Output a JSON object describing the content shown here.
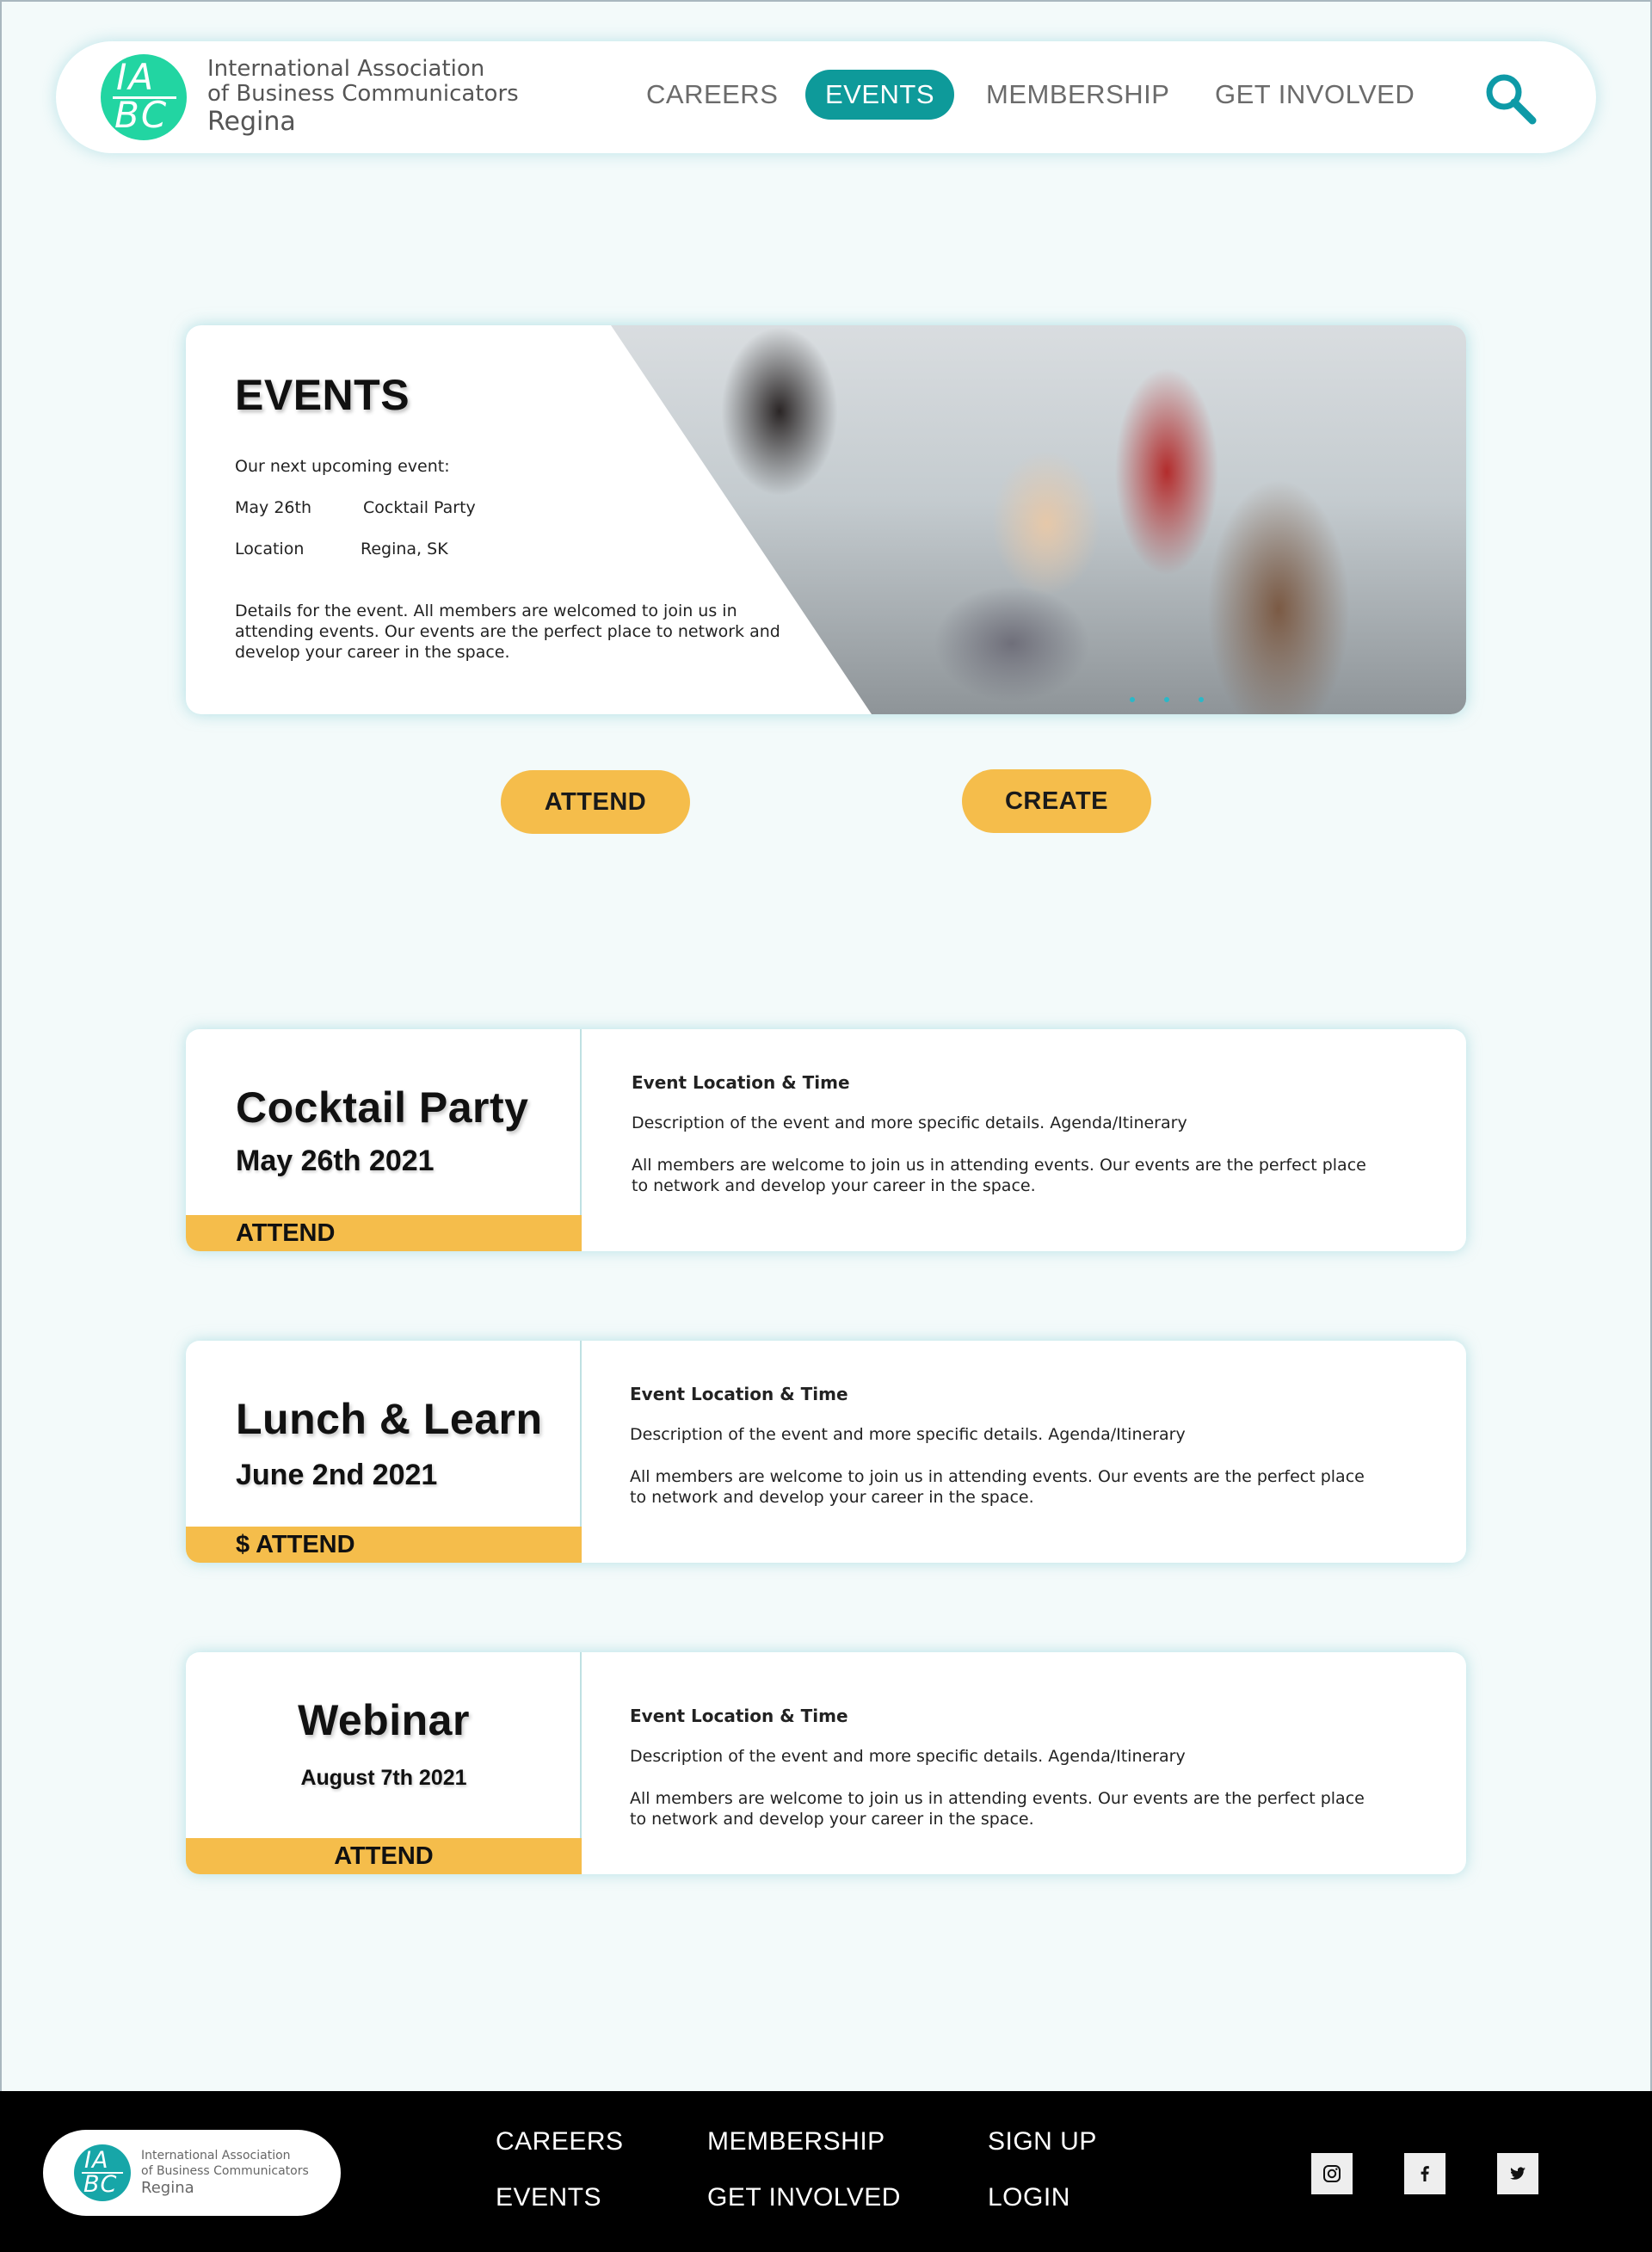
{
  "header": {
    "logo": {
      "mark_top": "IA",
      "mark_bottom": "BC",
      "line1": "International Association",
      "line2": "of Business Communicators",
      "line3": "Regina"
    },
    "nav": [
      {
        "label": "CAREERS",
        "active": false
      },
      {
        "label": "EVENTS",
        "active": true
      },
      {
        "label": "MEMBERSHIP",
        "active": false
      },
      {
        "label": "GET INVOLVED",
        "active": false
      }
    ],
    "search_icon": "search-icon"
  },
  "hero": {
    "title": "EVENTS",
    "upcoming_label": "Our next upcoming event:",
    "date": "May 26th",
    "event_name": "Cocktail Party",
    "location_label": "Location",
    "location_value": "Regina, SK",
    "details": "Details for the event. All members are welcomed to join us in attending events. Our events are the perfect place to network and develop your career in the space.",
    "carousel_dots": 3
  },
  "actions": {
    "attend": "ATTEND",
    "create": "CREATE"
  },
  "events": [
    {
      "name": "Cocktail Party",
      "date": "May 26th 2021",
      "attend": "ATTEND",
      "location_time": "Event Location & Time",
      "description": "Description of the event and more specific details. Agenda/Itinerary",
      "body": "All members are welcome to join us in attending events. Our events are the perfect place to network and develop your career in the space."
    },
    {
      "name": "Lunch & Learn",
      "date": "June 2nd 2021",
      "attend": "$ ATTEND",
      "location_time": "Event Location & Time",
      "description": "Description of the event and more specific details. Agenda/Itinerary",
      "body": "All members are welcome to join us in attending events. Our events are the perfect place to network and develop your career in the space."
    },
    {
      "name": "Webinar",
      "date": "August 7th 2021",
      "attend": "ATTEND",
      "location_time": "Event Location & Time",
      "description": "Description of the event and more specific details. Agenda/Itinerary",
      "body": "All members are welcome to join us in attending events. Our events are the perfect place to network and develop your career in the space."
    }
  ],
  "footer": {
    "logo": {
      "mark_top": "IA",
      "mark_bottom": "BC",
      "line1": "International Association",
      "line2": "of Business Communicators",
      "line3": "Regina"
    },
    "links": {
      "careers": "CAREERS",
      "events": "EVENTS",
      "membership": "MEMBERSHIP",
      "get_involved": "GET INVOLVED",
      "sign_up": "SIGN UP",
      "login": "LOGIN"
    },
    "social": [
      "instagram-icon",
      "facebook-icon",
      "twitter-icon"
    ]
  },
  "colors": {
    "accent": "#0e9a9a",
    "button": "#f5bd4b",
    "logo_green": "#22d5a2",
    "background": "#f3fafa"
  }
}
